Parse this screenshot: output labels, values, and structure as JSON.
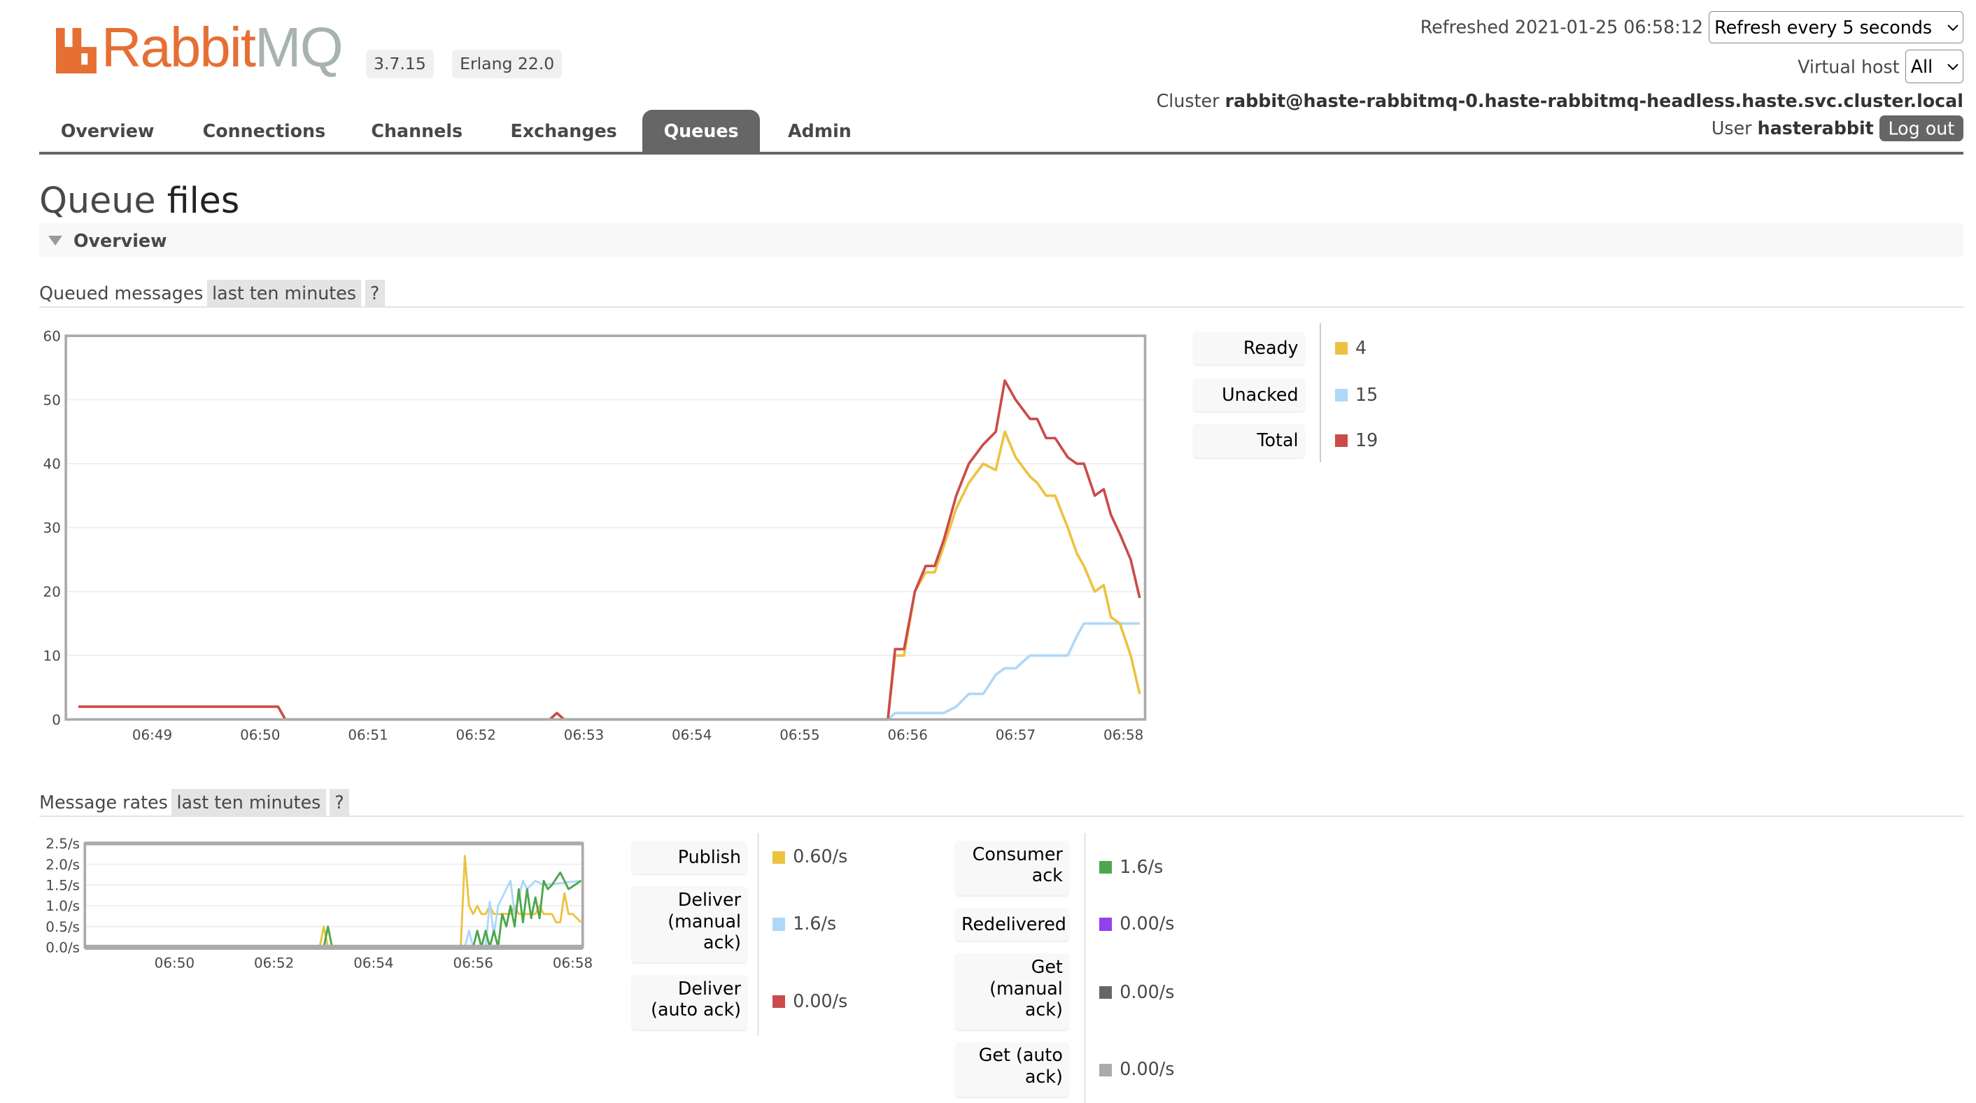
{
  "header": {
    "logo_text": "RabbitMQ",
    "version": "3.7.15",
    "erlang": "Erlang 22.0",
    "refreshed_label": "Refreshed 2021-01-25 06:58:12",
    "refresh_select": "Refresh every 5 seconds",
    "vhost_label": "Virtual host",
    "vhost_select": "All",
    "cluster_label": "Cluster",
    "cluster_name": "rabbit@haste-rabbitmq-0.haste-rabbitmq-headless.haste.svc.cluster.local",
    "user_label": "User",
    "user_name": "hasterabbit",
    "logout": "Log out"
  },
  "nav": {
    "tabs": [
      {
        "label": "Overview"
      },
      {
        "label": "Connections"
      },
      {
        "label": "Channels"
      },
      {
        "label": "Exchanges"
      },
      {
        "label": "Queues",
        "active": true
      },
      {
        "label": "Admin"
      }
    ]
  },
  "page": {
    "title_prefix": "Queue",
    "title_name": "files",
    "section": "Overview"
  },
  "colors": {
    "ready": "#edc240",
    "unacked": "#afd8f8",
    "total": "#cb4b4b",
    "publish": "#edc240",
    "deliver_manual": "#afd8f8",
    "deliver_auto": "#cb4b4b",
    "consumer_ack": "#4da74d",
    "redelivered": "#9440ed",
    "get_manual": "#666666",
    "get_auto": "#aaaaaa",
    "logo_orange": "#e66f33"
  },
  "queued": {
    "heading": "Queued messages",
    "range": "last ten minutes",
    "help": "?",
    "legend": [
      {
        "label": "Ready",
        "value": "4",
        "color": "#edc240"
      },
      {
        "label": "Unacked",
        "value": "15",
        "color": "#afd8f8"
      },
      {
        "label": "Total",
        "value": "19",
        "color": "#cb4b4b"
      }
    ]
  },
  "rates": {
    "heading": "Message rates",
    "range": "last ten minutes",
    "help": "?",
    "legend_left": [
      {
        "label": "Publish",
        "value": "0.60/s",
        "color": "#edc240"
      },
      {
        "label": "Deliver (manual ack)",
        "value": "1.6/s",
        "color": "#afd8f8"
      },
      {
        "label": "Deliver (auto ack)",
        "value": "0.00/s",
        "color": "#cb4b4b"
      }
    ],
    "legend_right": [
      {
        "label": "Consumer ack",
        "value": "1.6/s",
        "color": "#4da74d"
      },
      {
        "label": "Redelivered",
        "value": "0.00/s",
        "color": "#9440ed"
      },
      {
        "label": "Get (manual ack)",
        "value": "0.00/s",
        "color": "#666666"
      },
      {
        "label": "Get (auto ack)",
        "value": "0.00/s",
        "color": "#aaaaaa"
      }
    ]
  },
  "chart_data": [
    {
      "type": "line",
      "xlim": [
        "06:48:12",
        "06:58:12"
      ],
      "ylim": [
        0,
        60
      ],
      "xticks": [
        "06:49",
        "06:50",
        "06:51",
        "06:52",
        "06:53",
        "06:54",
        "06:55",
        "06:56",
        "06:57",
        "06:58"
      ],
      "yticks": [
        "0",
        "10",
        "20",
        "30",
        "40",
        "50",
        "60"
      ],
      "grid": true,
      "x": [
        "06:48:19",
        "06:50:10",
        "06:50:14",
        "06:52:41",
        "06:52:45",
        "06:52:49",
        "06:55:49",
        "06:55:53",
        "06:55:58",
        "06:56:04",
        "06:56:10",
        "06:56:15",
        "06:56:20",
        "06:56:27",
        "06:56:34",
        "06:56:42",
        "06:56:49",
        "06:56:54",
        "06:57:00",
        "06:57:08",
        "06:57:12",
        "06:57:17",
        "06:57:22",
        "06:57:29",
        "06:57:34",
        "06:57:38",
        "06:57:44",
        "06:57:49",
        "06:57:53",
        "06:57:58",
        "06:58:04",
        "06:58:09"
      ],
      "series": [
        {
          "name": "Unacked",
          "color": "#afd8f8",
          "values": [
            0,
            0,
            0,
            0,
            0,
            0,
            0,
            1,
            1,
            1,
            1,
            1,
            1,
            2,
            4,
            4,
            7,
            8,
            8,
            10,
            10,
            10,
            10,
            10,
            13,
            15,
            15,
            15,
            15,
            15,
            15,
            15
          ]
        },
        {
          "name": "Ready",
          "color": "#edc240",
          "values": [
            2,
            2,
            0,
            0,
            1,
            0,
            0,
            10,
            10,
            20,
            23,
            23,
            27,
            33,
            37,
            40,
            39,
            45,
            41,
            38,
            37,
            35,
            35,
            30,
            26,
            24,
            20,
            21,
            16,
            15,
            10,
            4
          ]
        },
        {
          "name": "Total",
          "color": "#cb4b4b",
          "values": [
            2,
            2,
            0,
            0,
            1,
            0,
            0,
            11,
            11,
            20,
            24,
            24,
            28,
            35,
            40,
            43,
            45,
            53,
            50,
            47,
            47,
            44,
            44,
            41,
            40,
            40,
            35,
            36,
            32,
            29,
            25,
            19
          ]
        }
      ]
    },
    {
      "type": "line",
      "xlim": [
        "06:48:12",
        "06:58:12"
      ],
      "ylim": [
        0,
        2.5
      ],
      "xticks": [
        "06:50",
        "06:52",
        "06:54",
        "06:56",
        "06:58"
      ],
      "yticks": [
        "0.0/s",
        "0.5/s",
        "1.0/s",
        "1.5/s",
        "2.0/s",
        "2.5/s"
      ],
      "grid": true,
      "series": [
        {
          "name": "Publish",
          "color": "#edc240",
          "points": [
            [
              "06:48:12",
              0
            ],
            [
              "06:52:55",
              0
            ],
            [
              "06:53:00",
              0.5
            ],
            [
              "06:53:05",
              0
            ],
            [
              "06:55:45",
              0
            ],
            [
              "06:55:50",
              2.2
            ],
            [
              "06:55:55",
              1.0
            ],
            [
              "06:56:00",
              0.8
            ],
            [
              "06:56:05",
              1.0
            ],
            [
              "06:56:10",
              0.8
            ],
            [
              "06:56:15",
              0.8
            ],
            [
              "06:56:20",
              1.0
            ],
            [
              "06:56:25",
              0.8
            ],
            [
              "06:56:45",
              0.8
            ],
            [
              "06:56:50",
              1.0
            ],
            [
              "06:56:55",
              0.8
            ],
            [
              "06:57:15",
              0.8
            ],
            [
              "06:57:20",
              1.0
            ],
            [
              "06:57:25",
              0.8
            ],
            [
              "06:57:35",
              0.8
            ],
            [
              "06:57:40",
              0.6
            ],
            [
              "06:57:45",
              0.6
            ],
            [
              "06:57:50",
              1.3
            ],
            [
              "06:57:55",
              0.8
            ],
            [
              "06:58:00",
              0.8
            ],
            [
              "06:58:10",
              0.6
            ]
          ]
        },
        {
          "name": "Deliver (manual ack)",
          "color": "#afd8f8",
          "points": [
            [
              "06:55:50",
              0
            ],
            [
              "06:55:55",
              0.4
            ],
            [
              "06:56:00",
              0
            ],
            [
              "06:56:15",
              0
            ],
            [
              "06:56:20",
              1.1
            ],
            [
              "06:56:25",
              0.3
            ],
            [
              "06:56:30",
              1.0
            ],
            [
              "06:56:35",
              1.2
            ],
            [
              "06:56:45",
              1.6
            ],
            [
              "06:56:50",
              0.8
            ],
            [
              "06:57:00",
              1.6
            ],
            [
              "06:57:05",
              1.4
            ],
            [
              "06:57:15",
              1.6
            ],
            [
              "06:57:25",
              1.5
            ],
            [
              "06:58:10",
              1.6
            ]
          ]
        },
        {
          "name": "Consumer ack",
          "color": "#4da74d",
          "points": [
            [
              "06:48:12",
              0
            ],
            [
              "06:53:00",
              0
            ],
            [
              "06:53:05",
              0.5
            ],
            [
              "06:53:10",
              0
            ],
            [
              "06:56:00",
              0
            ],
            [
              "06:56:05",
              0.4
            ],
            [
              "06:56:10",
              0
            ],
            [
              "06:56:15",
              0.4
            ],
            [
              "06:56:20",
              0
            ],
            [
              "06:56:25",
              0.4
            ],
            [
              "06:56:30",
              0
            ],
            [
              "06:56:35",
              0.8
            ],
            [
              "06:56:40",
              0.5
            ],
            [
              "06:56:45",
              1.0
            ],
            [
              "06:56:50",
              0.5
            ],
            [
              "06:56:55",
              1.4
            ],
            [
              "06:57:00",
              0.6
            ],
            [
              "06:57:05",
              1.4
            ],
            [
              "06:57:10",
              0.7
            ],
            [
              "06:57:15",
              1.2
            ],
            [
              "06:57:20",
              0.7
            ],
            [
              "06:57:25",
              1.6
            ],
            [
              "06:57:30",
              1.4
            ],
            [
              "06:57:35",
              1.5
            ],
            [
              "06:57:45",
              1.8
            ],
            [
              "06:57:55",
              1.4
            ],
            [
              "06:58:10",
              1.6
            ]
          ]
        }
      ]
    }
  ]
}
